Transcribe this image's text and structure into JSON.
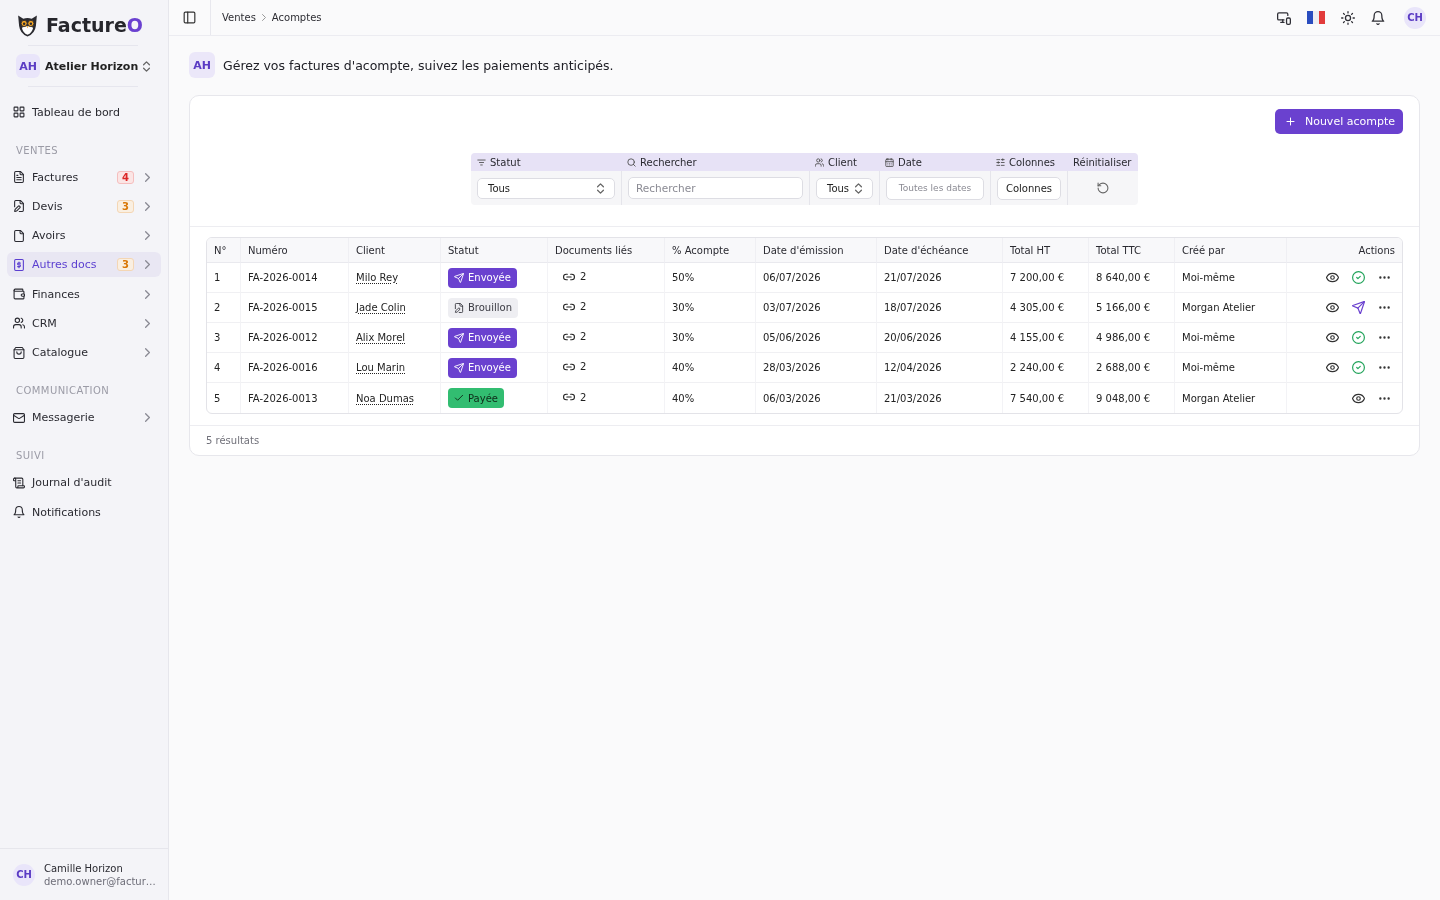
{
  "sidebar": {
    "brand": {
      "name": "Facture",
      "accent": "O"
    },
    "workspace": {
      "initials": "AH",
      "name": "Atelier Horizon"
    },
    "groups": [
      {
        "items": [
          {
            "label": "Tableau de bord",
            "selected": false,
            "expandable": false
          }
        ]
      },
      {
        "title": "VENTES",
        "items": [
          {
            "label": "Factures",
            "badge": {
              "text": "4",
              "color": "#dc2626"
            },
            "selected": false,
            "expandable": true
          },
          {
            "label": "Devis",
            "badge": {
              "text": "3",
              "color": "#d97706"
            },
            "selected": false,
            "expandable": true
          },
          {
            "label": "Avoirs",
            "selected": false,
            "expandable": true
          },
          {
            "label": "Autres docs",
            "badge": {
              "text": "3",
              "color": "#d97706"
            },
            "selected": true,
            "expandable": true
          },
          {
            "label": "Finances",
            "selected": false,
            "expandable": true
          },
          {
            "label": "CRM",
            "selected": false,
            "expandable": true
          },
          {
            "label": "Catalogue",
            "selected": false,
            "expandable": true
          }
        ]
      },
      {
        "title": "COMMUNICATION",
        "items": [
          {
            "label": "Messagerie",
            "selected": false,
            "expandable": true
          }
        ]
      },
      {
        "title": "SUIVI",
        "items": [
          {
            "label": "Journal d'audit",
            "selected": false,
            "expandable": false
          },
          {
            "label": "Notifications",
            "selected": false,
            "expandable": false
          }
        ]
      }
    ],
    "user": {
      "initials": "CH",
      "name": "Camille Horizon",
      "email": "demo.owner@factur…"
    }
  },
  "topbar": {
    "breadcrumb": [
      "Ventes",
      "Acomptes"
    ],
    "avatar": "CH"
  },
  "intro": {
    "initials": "AH",
    "text": "Gérez vos factures d'acompte, suivez les paiements anticipés."
  },
  "card": {
    "primary_button": "Nouvel acompte",
    "filters": [
      {
        "kind": "select",
        "label": "Statut",
        "value": "Tous"
      },
      {
        "kind": "search",
        "label": "Rechercher",
        "placeholder": "Rechercher"
      },
      {
        "kind": "select",
        "label": "Client",
        "value": "Tous"
      },
      {
        "kind": "date",
        "label": "Date",
        "placeholder": "Toutes les dates"
      },
      {
        "kind": "button",
        "label": "Colonnes",
        "text": "Colonnes"
      },
      {
        "kind": "reset",
        "label": "Réinitialiser"
      }
    ],
    "table": {
      "columns": [
        "N°",
        "Numéro",
        "Client",
        "Statut",
        "Documents liés",
        "% Acompte",
        "Date d'émission",
        "Date d'échéance",
        "Total HT",
        "Total TTC",
        "Créé par",
        "Actions"
      ],
      "rows": [
        {
          "no": "1",
          "number": "FA-2026-0014",
          "client": "Milo Rey",
          "status": {
            "kind": "sent",
            "label": "Envoyée"
          },
          "linked_docs": "2",
          "deposit": "50%",
          "issue_date": "06/07/2026",
          "due_date": "21/07/2026",
          "total_ht": "7 200,00 €",
          "total_ttc": "8 640,00 €",
          "created_by": "Moi-même",
          "actions": [
            {
              "kind": "view"
            },
            {
              "kind": "approve"
            },
            {
              "kind": "more"
            }
          ]
        },
        {
          "no": "2",
          "number": "FA-2026-0015",
          "client": "Jade Colin",
          "status": {
            "kind": "draft",
            "label": "Brouillon"
          },
          "linked_docs": "2",
          "deposit": "30%",
          "issue_date": "03/07/2026",
          "due_date": "18/07/2026",
          "total_ht": "4 305,00 €",
          "total_ttc": "5 166,00 €",
          "created_by": "Morgan Atelier",
          "actions": [
            {
              "kind": "view"
            },
            {
              "kind": "send"
            },
            {
              "kind": "more"
            }
          ]
        },
        {
          "no": "3",
          "number": "FA-2026-0012",
          "client": "Alix Morel",
          "status": {
            "kind": "sent",
            "label": "Envoyée"
          },
          "linked_docs": "2",
          "deposit": "30%",
          "issue_date": "05/06/2026",
          "due_date": "20/06/2026",
          "total_ht": "4 155,00 €",
          "total_ttc": "4 986,00 €",
          "created_by": "Moi-même",
          "actions": [
            {
              "kind": "view"
            },
            {
              "kind": "approve"
            },
            {
              "kind": "more"
            }
          ]
        },
        {
          "no": "4",
          "number": "FA-2026-0016",
          "client": "Lou Marin",
          "status": {
            "kind": "sent",
            "label": "Envoyée"
          },
          "linked_docs": "2",
          "deposit": "40%",
          "issue_date": "28/03/2026",
          "due_date": "12/04/2026",
          "total_ht": "2 240,00 €",
          "total_ttc": "2 688,00 €",
          "created_by": "Moi-même",
          "actions": [
            {
              "kind": "view"
            },
            {
              "kind": "approve"
            },
            {
              "kind": "more"
            }
          ]
        },
        {
          "no": "5",
          "number": "FA-2026-0013",
          "client": "Noa Dumas",
          "status": {
            "kind": "paid",
            "label": "Payée"
          },
          "linked_docs": "2",
          "deposit": "40%",
          "issue_date": "06/03/2026",
          "due_date": "21/03/2026",
          "total_ht": "7 540,00 €",
          "total_ttc": "9 048,00 €",
          "created_by": "Morgan Atelier",
          "actions": [
            {
              "kind": "view"
            },
            {
              "kind": "more"
            }
          ]
        }
      ]
    },
    "footer": "5 résultats"
  }
}
